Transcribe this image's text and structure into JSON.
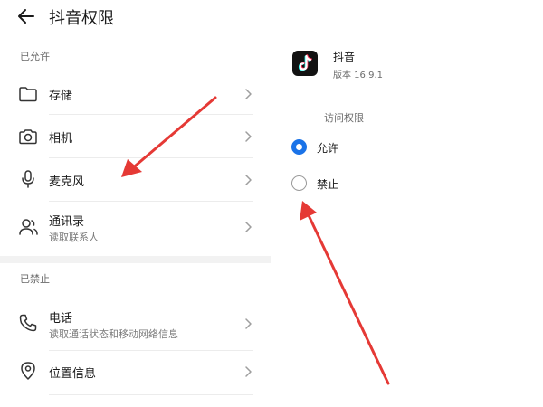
{
  "header": {
    "title": "抖音权限"
  },
  "left": {
    "allowed_section": "已允许",
    "denied_section": "已禁止",
    "allowed_items": [
      {
        "title": "存储",
        "subtitle": "",
        "icon": "folder-icon"
      },
      {
        "title": "相机",
        "subtitle": "",
        "icon": "camera-icon"
      },
      {
        "title": "麦克风",
        "subtitle": "",
        "icon": "microphone-icon"
      },
      {
        "title": "通讯录",
        "subtitle": "读取联系人",
        "icon": "contacts-icon"
      }
    ],
    "denied_items": [
      {
        "title": "电话",
        "subtitle": "读取通话状态和移动网络信息",
        "icon": "phone-icon"
      },
      {
        "title": "位置信息",
        "subtitle": "",
        "icon": "location-icon"
      }
    ]
  },
  "right": {
    "app": {
      "name": "抖音",
      "version": "版本 16.9.1",
      "icon": "tiktok-logo-icon"
    },
    "access_label": "访问权限",
    "options": [
      {
        "label": "允许",
        "selected": true
      },
      {
        "label": "禁止",
        "selected": false
      }
    ]
  },
  "colors": {
    "accent": "#1a73e8",
    "annotation_arrow": "#e53935",
    "app_icon_bg": "#121212"
  }
}
